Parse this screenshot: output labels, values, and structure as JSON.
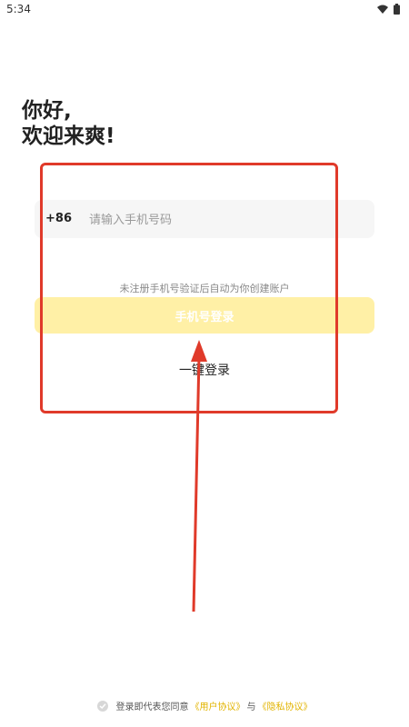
{
  "status_bar": {
    "time": "5:34",
    "wifi_icon": "wifi-icon",
    "battery_icon": "battery-icon"
  },
  "greeting": {
    "line1": "你好,",
    "line2": "欢迎来爽!"
  },
  "phone": {
    "country_code": "+86",
    "placeholder": "请输入手机号码"
  },
  "hint": "未注册手机号验证后自动为你创建账户",
  "buttons": {
    "phone_login": "手机号登录",
    "one_click": "一键登录"
  },
  "agreement": {
    "prefix": "登录即代表您同意",
    "user_agreement": "《用户协议》",
    "and": "与",
    "privacy_policy": "《隐私协议》"
  },
  "colors": {
    "accent": "#f5c518",
    "button_bg": "#fff0a6",
    "annotation": "#e03a2a"
  }
}
